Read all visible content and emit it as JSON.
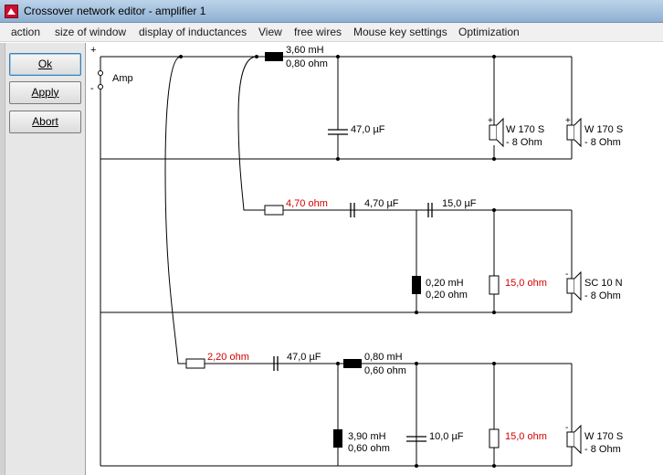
{
  "window": {
    "title": "Crossover network editor - amplifier 1",
    "icon": "red-crossover-app-icon"
  },
  "menu": [
    "action",
    "size of window",
    "display of inductances",
    "View",
    "free wires",
    "Mouse key settings",
    "Optimization"
  ],
  "buttons": {
    "ok": "Ok",
    "apply": "Apply",
    "abort": "Abort"
  },
  "amp": {
    "label": "Amp",
    "plus": "+",
    "minus": "-"
  },
  "branch1": {
    "inductor_value": "3,60 mH",
    "inductor_resistance": "0,80 ohm",
    "capacitor": "47,0 µF",
    "speaker1_name": "W 170 S",
    "speaker1_impedance": "- 8 Ohm",
    "speaker2_name": "W 170 S",
    "speaker2_impedance": "- 8 Ohm"
  },
  "branch2": {
    "resistor": "4,70 ohm",
    "capacitor1": "4,70 µF",
    "capacitor2": "15,0 µF",
    "inductor_value": "0,20 mH",
    "inductor_resistance": "0,20 ohm",
    "shunt_resistor": "15,0 ohm",
    "speaker_name": "SC 10 N",
    "speaker_impedance": "- 8 Ohm"
  },
  "branch3": {
    "resistor": "2,20 ohm",
    "capacitor1": "47,0 µF",
    "inductor1_value": "0,80 mH",
    "inductor1_resistance": "0,60 ohm",
    "inductor2_value": "3,90 mH",
    "inductor2_resistance": "0,60 ohm",
    "capacitor2": "10,0 µF",
    "shunt_resistor": "15,0 ohm",
    "speaker_name": "W 170 S",
    "speaker_impedance": "- 8 Ohm"
  },
  "colors": {
    "wire": "#000000",
    "component_fill": "#000000",
    "value_highlight": "#d40000",
    "titlebar": "#a7c3e0",
    "panel": "#e7e7e7"
  }
}
